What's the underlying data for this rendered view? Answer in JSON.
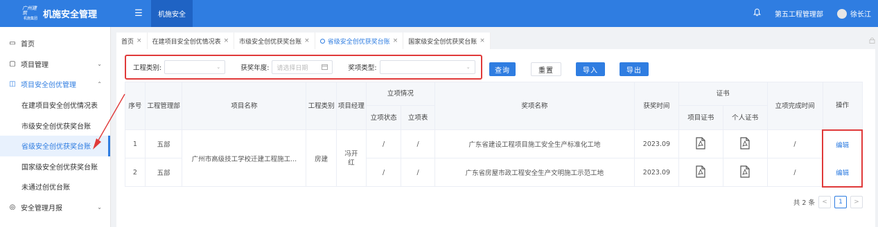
{
  "app": {
    "title": "机施安全管理",
    "logo_top": "广州建筑",
    "logo_bottom": "机施集团",
    "menu_toggle_glyph": "☰"
  },
  "topbar": {
    "nav_label": "机施安全",
    "department": "第五工程管理部",
    "user": "徐长江"
  },
  "sidebar": {
    "items": [
      {
        "label": "首页",
        "icon": "home-icon",
        "glyph": "▭"
      },
      {
        "label": "项目管理",
        "icon": "folder-icon",
        "glyph": "▢",
        "arrow": "⌄"
      },
      {
        "label": "项目安全创优管理",
        "icon": "shield-icon",
        "glyph": "◫",
        "arrow": "⌃"
      }
    ],
    "sub_items": [
      {
        "label": "在建项目安全创优情况表"
      },
      {
        "label": "市级安全创优获奖台账"
      },
      {
        "label": "省级安全创优获奖台账"
      },
      {
        "label": "国家级安全创优获奖台账"
      },
      {
        "label": "未通过创优台账"
      }
    ],
    "bottom_items": [
      {
        "label": "安全管理月报",
        "icon": "report-icon",
        "glyph": "◎",
        "arrow": "⌄"
      }
    ]
  },
  "tabs": [
    {
      "label": "首页",
      "active": false
    },
    {
      "label": "在建项目安全创优情况表",
      "active": false
    },
    {
      "label": "市级安全创优获奖台账",
      "active": false
    },
    {
      "label": "省级安全创优获奖台账",
      "active": true
    },
    {
      "label": "国家级安全创优获奖台账",
      "active": false
    }
  ],
  "filters": {
    "project_type_label": "工程类别:",
    "project_type_value": "",
    "award_year_label": "获奖年度:",
    "award_year_placeholder": "请选择日期",
    "award_type_label": "奖项类型:",
    "award_type_value": ""
  },
  "buttons": {
    "query": "查询",
    "reset": "重置",
    "import": "导入",
    "export": "导出"
  },
  "table": {
    "headers": {
      "seq": "序号",
      "dept": "工程管理部",
      "project_name": "项目名称",
      "project_type": "工程类别",
      "manager": "项目经理",
      "approval_group": "立项情况",
      "approval_status": "立项状态",
      "approval_form": "立项表",
      "award_name": "奖项名称",
      "award_time": "获奖时间",
      "cert_group": "证书",
      "project_cert": "项目证书",
      "personal_cert": "个人证书",
      "completion_time": "立项完成时间",
      "operation": "操作"
    },
    "merged": {
      "project_name": "广州市高级技工学校迁建工程施工...",
      "project_type": "房建",
      "manager": "冯开红"
    },
    "rows": [
      {
        "seq": "1",
        "dept": "五部",
        "approval_status": "/",
        "approval_form": "/",
        "award_name": "广东省建设工程项目施工安全生产标准化工地",
        "award_time": "2023.09",
        "completion_time": "/",
        "operation": "编辑"
      },
      {
        "seq": "2",
        "dept": "五部",
        "approval_status": "/",
        "approval_form": "/",
        "award_name": "广东省房屋市政工程安全生产文明施工示范工地",
        "award_time": "2023.09",
        "completion_time": "/",
        "operation": "编辑"
      }
    ]
  },
  "pagination": {
    "total_text": "共 2 条",
    "current_page": "1",
    "prev": "<",
    "next": ">"
  },
  "colors": {
    "primary": "#2f7de1",
    "annotation": "#e03a3a"
  }
}
